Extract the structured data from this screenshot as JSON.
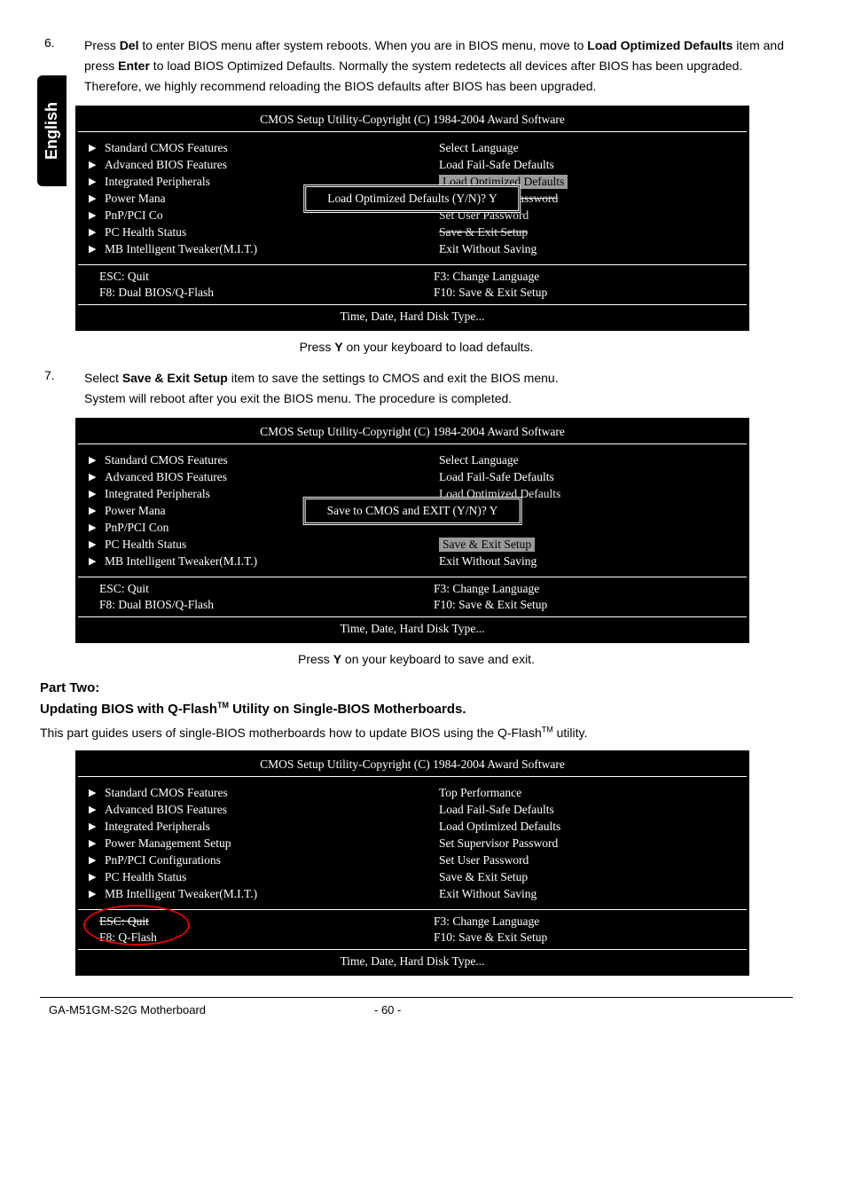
{
  "langTab": "English",
  "steps": {
    "six": {
      "num": "6.",
      "text_parts": [
        "Press ",
        "Del",
        " to enter BIOS menu after system reboots. When you are in BIOS menu, move to ",
        "Load Optimized Defaults",
        " item and press ",
        "Enter",
        " to load BIOS Optimized Defaults. Normally the system redetects all devices after BIOS has been upgraded. Therefore, we highly recommend reloading the BIOS defaults after BIOS has been upgraded."
      ]
    },
    "seven": {
      "num": "7.",
      "line1_parts": [
        "Select ",
        "Save & Exit Setup",
        " item to save the settings to CMOS and exit the BIOS menu."
      ],
      "line2": "System will reboot after you exit the BIOS menu. The procedure is completed."
    }
  },
  "biosCommon": {
    "title": "CMOS Setup Utility-Copyright (C) 1984-2004 Award Software",
    "leftMenu": [
      "Standard CMOS Features",
      "Advanced BIOS Features",
      "Integrated Peripherals",
      "Power Management Setup",
      "PnP/PCI Configurations",
      "PC Health Status",
      "MB Intelligent Tweaker(M.I.T.)"
    ],
    "keys": {
      "esc": "ESC: Quit",
      "f3": "F3: Change Language",
      "f8dual": "F8: Dual BIOS/Q-Flash",
      "f8q": "F8: Q-Flash",
      "f10": "F10: Save & Exit Setup"
    },
    "footer": "Time, Date, Hard Disk Type..."
  },
  "bios1": {
    "rightMenu": [
      "Select Language",
      "Load Fail-Safe Defaults"
    ],
    "highlighted": "Load Optimized Defaults",
    "underDialogRight": [
      "Set Supervisor Password",
      "Set User Password",
      "Save & Exit Setup"
    ],
    "lastRight": "Exit Without Saving",
    "dialog": "Load Optimized Defaults (Y/N)? Y",
    "leftTrunc": {
      "power": "Power Mana",
      "pnp": "PnP/PCI Co",
      "pc": "PC Health Status"
    }
  },
  "bios2": {
    "rightMenu": [
      "Select Language",
      "Load Fail-Safe Defaults",
      "Load Optimized Defaults"
    ],
    "highlighted": "Save & Exit Setup",
    "lastRight": "Exit Without Saving",
    "dialog": "Save to CMOS and EXIT (Y/N)? Y",
    "leftTrunc": {
      "power": "Power Mana",
      "pnp": "PnP/PCI Con"
    }
  },
  "bios3": {
    "rightMenu": [
      "Top Performance",
      "Load Fail-Safe Defaults",
      "Load Optimized Defaults",
      "Set Supervisor Password",
      "Set User Password",
      "Save & Exit Setup",
      "Exit Without Saving"
    ]
  },
  "captions": {
    "c1_parts": [
      "Press ",
      "Y",
      " on your keyboard to load defaults."
    ],
    "c2_parts": [
      "Press ",
      "Y",
      " on your keyboard to save and exit."
    ]
  },
  "partTwo": {
    "heading": "Part Two:",
    "sub_before": "Updating BIOS with Q-Flash",
    "sub_after": " Utility on Single-BIOS Motherboards.",
    "intro_before": "This part guides users of single-BIOS motherboards how to update BIOS using the Q-Flash",
    "intro_after": " utility."
  },
  "footer": {
    "model": "GA-M51GM-S2G Motherboard",
    "page": "- 60 -"
  }
}
